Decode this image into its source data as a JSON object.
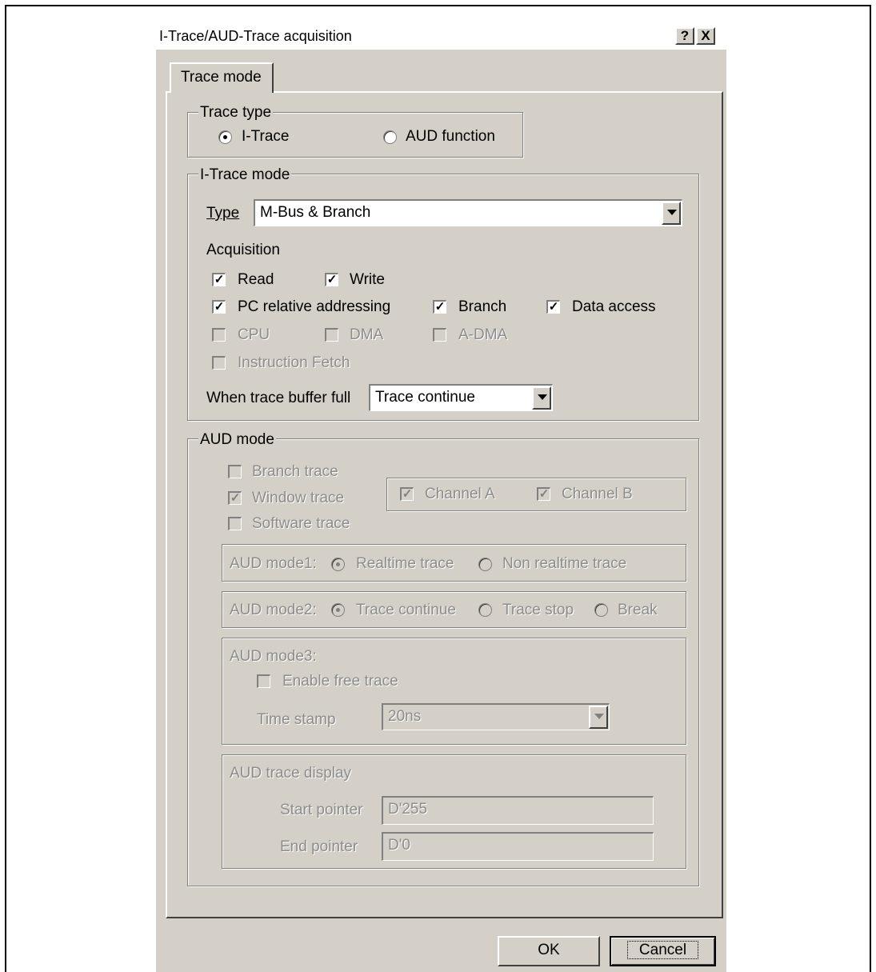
{
  "dialog": {
    "title": "I-Trace/AUD-Trace acquisition",
    "help_label": "?",
    "close_label": "X",
    "tab_label": "Trace mode"
  },
  "trace_type": {
    "group_label": "Trace type",
    "itrace_label": "I-Trace",
    "aud_label": "AUD function",
    "selected": "I-Trace"
  },
  "itrace_mode": {
    "group_label": "I-Trace mode",
    "type_label": "Type",
    "type_value": "M-Bus & Branch",
    "acquisition_label": "Acquisition",
    "checkboxes": {
      "read": {
        "label": "Read",
        "checked": true
      },
      "write": {
        "label": "Write",
        "checked": true
      },
      "pc_relative": {
        "label": "PC relative addressing",
        "checked": true
      },
      "branch": {
        "label": "Branch",
        "checked": true
      },
      "data_access": {
        "label": "Data access",
        "checked": true
      },
      "cpu": {
        "label": "CPU",
        "checked": false
      },
      "dma": {
        "label": "DMA",
        "checked": false
      },
      "adma": {
        "label": "A-DMA",
        "checked": false
      },
      "instruction_fetch": {
        "label": "Instruction Fetch",
        "checked": false
      }
    },
    "buffer_full_label": "When trace buffer full",
    "buffer_full_value": "Trace continue"
  },
  "aud_mode": {
    "group_label": "AUD mode",
    "branch_trace": "Branch trace",
    "window_trace": "Window trace",
    "software_trace": "Software trace",
    "channel_a": "Channel A",
    "channel_b": "Channel B",
    "mode1_label": "AUD mode1:",
    "mode1_realtime": "Realtime trace",
    "mode1_nonrealtime": "Non realtime trace",
    "mode2_label": "AUD mode2:",
    "mode2_continue": "Trace continue",
    "mode2_stop": "Trace stop",
    "mode2_break": "Break",
    "mode3_label": "AUD mode3:",
    "enable_free_trace": "Enable free trace",
    "time_stamp_label": "Time stamp",
    "time_stamp_value": "20ns",
    "display_label": "AUD trace display",
    "start_pointer_label": "Start pointer",
    "start_pointer_value": "D'255",
    "end_pointer_label": "End pointer",
    "end_pointer_value": "D'0"
  },
  "buttons": {
    "ok": "OK",
    "cancel": "Cancel"
  }
}
